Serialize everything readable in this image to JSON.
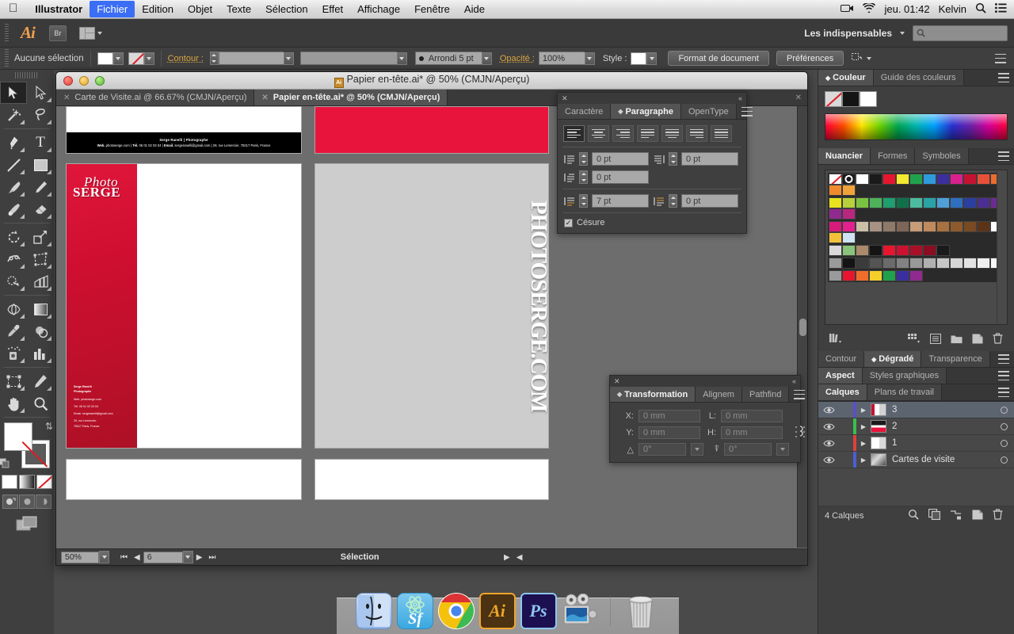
{
  "os_menubar": {
    "apple_icon": "apple-icon",
    "app_name": "Illustrator",
    "menus": [
      "Fichier",
      "Edition",
      "Objet",
      "Texte",
      "Sélection",
      "Effet",
      "Affichage",
      "Fenêtre",
      "Aide"
    ],
    "active_menu": "Fichier",
    "status": {
      "screen_record_icon": "video-camera-icon",
      "wifi_icon": "wifi-icon",
      "datetime": "jeu. 01:42",
      "user": "Kelvin",
      "search_icon": "search-icon",
      "notification_icon": "notification-list-icon"
    }
  },
  "appbar": {
    "logo": "Ai",
    "bridge_label": "Br",
    "arrange_icon": "arrange-documents-icon",
    "workspace": "Les indispensables",
    "workspace_caret": "chevron-down-icon",
    "search_placeholder": "",
    "search_icon": "search-icon"
  },
  "controlbar": {
    "selection_status": "Aucune sélection",
    "fill_swatch": "white",
    "stroke_swatch": "none",
    "stroke_label": "Contour :",
    "stroke_weight": "",
    "stroke_profile": "",
    "brush_label": "Arrondi 5 pt",
    "opacity_label": "Opacité :",
    "opacity_value": "100%",
    "style_label": "Style :",
    "doc_setup_button": "Format de document",
    "preferences_button": "Préférences",
    "align_icon": "align-icon",
    "panel_menu_icon": "panel-menu-icon"
  },
  "tools": {
    "rows": [
      [
        "selection-tool",
        "direct-selection-tool"
      ],
      [
        "magic-wand-tool",
        "lasso-tool"
      ],
      [
        "pen-tool",
        "type-tool"
      ],
      [
        "line-segment-tool",
        "rectangle-tool"
      ],
      [
        "paintbrush-tool",
        "pencil-tool"
      ],
      [
        "blob-brush-tool",
        "eraser-tool"
      ],
      [
        "rotate-tool",
        "scale-tool"
      ],
      [
        "width-tool",
        "free-transform-tool"
      ],
      [
        "shape-builder-tool",
        "perspective-grid-tool"
      ],
      [
        "mesh-tool",
        "gradient-tool"
      ],
      [
        "eyedropper-tool",
        "blend-tool"
      ],
      [
        "symbol-sprayer-tool",
        "column-graph-tool"
      ],
      [
        "artboard-tool",
        "slice-tool"
      ],
      [
        "hand-tool",
        "zoom-tool"
      ]
    ],
    "fill_color": "#ffffff",
    "stroke_color": "#ffffff",
    "swap_icon": "swap-fill-stroke-icon",
    "default_icon": "default-fill-stroke-icon",
    "mini_swatches": [
      "color-swatch",
      "gradient-swatch",
      "none-swatch"
    ],
    "draw_modes": [
      "draw-normal",
      "draw-behind",
      "draw-inside"
    ],
    "screen_mode_icon": "change-screen-mode-icon"
  },
  "document_window": {
    "title": "Papier en-tête.ai* @ 50% (CMJN/Aperçu)",
    "title_icon": "ai-document-icon",
    "traffic_lights": [
      "close-button",
      "minimize-button",
      "zoom-button"
    ],
    "tabs": [
      {
        "label": "Carte de Visite.ai @ 66.67% (CMJN/Aperçu)",
        "active": false,
        "close_icon": "close-tab-icon"
      },
      {
        "label": "Papier en-tête.ai* @ 50% (CMJN/Aperçu)",
        "active": true,
        "close_icon": "close-tab-icon"
      }
    ],
    "tabstrip_close_icon": "close-icon",
    "statusbar": {
      "zoom": "50%",
      "zoom_caret": "chevron-down-icon",
      "first_icon": "first-artboard-icon",
      "prev_icon": "previous-artboard-icon",
      "artboard": "6",
      "artboard_caret": "chevron-down-icon",
      "next_icon": "next-artboard-icon",
      "last_icon": "last-artboard-icon",
      "status_text": "Sélection",
      "status_caret": "status-menu-icon",
      "scroll_left_icon": "scroll-left-icon"
    }
  },
  "artwork": {
    "business_card": {
      "line1": "Serge Ranelli  |  Photographe",
      "line2_a": "Web.",
      "line2_b": " photoserge.com  |  ",
      "line2_c": "Tél.",
      "line2_d": " 06 01 02 03 04  |  ",
      "line2_e": "Email.",
      "line2_f": " sergeranelli@gmail.com  |  29, rue Lemercier, 75017 Paris, France"
    },
    "red_block_color": "#e8143c",
    "letterhead": {
      "logo_script": "Photo",
      "logo_name": "SERGE",
      "contact": [
        "Serge Ranelli",
        "Photographe",
        "Web. photoserge.com",
        "Tél. 06 01 02 03 04",
        "Email. sergeranelli@gmail.com",
        "29, rue Lemercier,",
        "75017 Paris, France"
      ],
      "band_color": "#cf0f30"
    },
    "gray_sheet": {
      "vertical_text": "PHOTOSERGE.COM",
      "background": "#cdcdcd"
    }
  },
  "paragraph_panel": {
    "close_icon": "close-icon",
    "collapse_icon": "collapse-panel-icon",
    "tabs": [
      "Caractère",
      "Paragraphe",
      "OpenType"
    ],
    "active_tab": "Paragraphe",
    "menu_icon": "panel-menu-icon",
    "align_buttons": [
      "align-left",
      "align-center",
      "align-right",
      "justify-last-left",
      "justify-last-center",
      "justify-last-right",
      "justify-all"
    ],
    "active_align": "align-left",
    "fields": [
      {
        "icon": "indent-left-icon",
        "value": "0 pt"
      },
      {
        "icon": "indent-right-icon",
        "value": "0 pt"
      },
      {
        "icon": "first-line-indent-icon",
        "value": "0 pt"
      },
      {
        "icon": "space-before-icon",
        "value": "7 pt"
      },
      {
        "icon": "space-after-icon",
        "value": "0 pt"
      }
    ],
    "hyphenate_label": "Césure",
    "hyphenate_checked": true
  },
  "transform_panel": {
    "close_icon": "close-icon",
    "collapse_icon": "collapse-panel-icon",
    "tabs": [
      "Transformation",
      "Alignem",
      "Pathfind"
    ],
    "active_tab": "Transformation",
    "menu_icon": "panel-menu-icon",
    "reference_point_icon": "reference-point-grid",
    "fields": {
      "x_label": "X:",
      "x_value": "0 mm",
      "y_label": "Y:",
      "y_value": "0 mm",
      "w_label": "L:",
      "w_value": "0 mm",
      "h_label": "H:",
      "h_value": "0 mm",
      "rotate_label": "rotate-icon",
      "rotate_value": "0°",
      "shear_label": "shear-icon",
      "shear_value": "0°"
    },
    "link_icon": "constrain-proportions-icon"
  },
  "dock_panels": {
    "color_group": {
      "tabs": [
        "Couleur",
        "Guide des couleurs"
      ],
      "active_tab": "Couleur",
      "menu_icon": "panel-menu-icon",
      "swatches": [
        "none-swatch",
        "black-swatch",
        "white-swatch"
      ],
      "spectrum_icon": "color-spectrum-ramp"
    },
    "swatches_group": {
      "tabs": [
        "Nuancier",
        "Formes",
        "Symboles"
      ],
      "active_tab": "Nuancier",
      "menu_icon": "panel-menu-icon",
      "colors_row1": [
        "#ffffff",
        "#9a9a9a",
        "#ffffff",
        "#1a1a1a",
        "#e8152f",
        "#f4e832",
        "#22a14c",
        "#2e9bdd",
        "#3b2fa0",
        "#d9208e",
        "#c41230",
        "#e8503a",
        "#ec6c2d",
        "#ef8b2c",
        "#f0a33a"
      ],
      "colors_row2": [
        "#e8e21f",
        "#b8d13a",
        "#7cc242",
        "#4fb15a",
        "#1f9e6e",
        "#10704a",
        "#4dbba0",
        "#2aa3a6",
        "#4f9fd8",
        "#2f6fc0",
        "#2a3f9e",
        "#4b2e91",
        "#6d2a91",
        "#8f2a8f",
        "#b8277f"
      ],
      "colors_row3": [
        "#d61b7a",
        "#e2218f",
        "#cbbfa8",
        "#a79182",
        "#8f7a6a",
        "#7d6557",
        "#c79c78",
        "#c08a5d",
        "#a9713f",
        "#8e5a2b",
        "#7a4a22",
        "#5c3317",
        "#ffffff",
        "#f4c23a",
        "#cfe3f2"
      ],
      "colors_row4": [
        "#d9d9d9",
        "#8ac37a",
        "#a98a6a",
        "#141414",
        "#e8152f",
        "#cc1230",
        "#a81028",
        "#8a0d21",
        "#1a1a1a"
      ],
      "colors_row5": [
        "#9a9a9a",
        "#141414",
        "#3b3b3b",
        "#545454",
        "#6b6b6b",
        "#828282",
        "#999999",
        "#b0b0b0",
        "#c7c7c7",
        "#d6d6d6",
        "#e3e3e3",
        "#f0f0f0",
        "#fafafa"
      ],
      "colors_row6": [
        "#9a9a9a",
        "#e8152f",
        "#ef6c2c",
        "#f4cf2a",
        "#22a14c",
        "#3b2fa0",
        "#8f2a8f"
      ],
      "footer_icons": [
        "swatch-libraries-icon",
        "show-swatch-kinds-icon",
        "swatch-options-icon",
        "new-color-group-icon",
        "new-swatch-icon",
        "delete-swatch-icon"
      ]
    },
    "stroke_group": {
      "tabs": [
        "Contour",
        "Dégradé",
        "Transparence"
      ],
      "active_tab": "Dégradé",
      "menu_icon": "panel-menu-icon"
    },
    "appearance_group": {
      "tabs": [
        "Aspect",
        "Styles graphiques"
      ],
      "active_tab": "Aspect",
      "menu_icon": "panel-menu-icon"
    },
    "layers_group": {
      "tabs": [
        "Calques",
        "Plans de travail"
      ],
      "active_tab": "Calques",
      "menu_icon": "panel-menu-icon",
      "rows": [
        {
          "name": "3",
          "color": "#5b4fc4",
          "selected": true,
          "eye_icon": "eye-icon",
          "expand_icon": "disclosure-triangle-icon",
          "target_icon": "target-circle-icon"
        },
        {
          "name": "2",
          "color": "#3bbf4a",
          "selected": false,
          "eye_icon": "eye-icon",
          "expand_icon": "disclosure-triangle-icon",
          "target_icon": "target-circle-icon"
        },
        {
          "name": "1",
          "color": "#e0403c",
          "selected": false,
          "eye_icon": "eye-icon",
          "expand_icon": "disclosure-triangle-icon",
          "target_icon": "target-circle-icon"
        },
        {
          "name": "Cartes de visite",
          "color": "#4a5fd0",
          "selected": false,
          "eye_icon": "eye-icon",
          "expand_icon": "disclosure-triangle-icon",
          "target_icon": "target-circle-icon"
        }
      ],
      "footer_count": "4 Calques",
      "footer_icons": [
        "locate-object-icon",
        "make-clipping-mask-icon",
        "create-new-sublayer-icon",
        "create-new-layer-icon",
        "delete-layer-icon"
      ]
    }
  },
  "mac_dock": {
    "items": [
      {
        "name": "finder-icon",
        "label": "Finder"
      },
      {
        "name": "sparkleshare-icon",
        "label": "Sf"
      },
      {
        "name": "chrome-icon",
        "label": "Chrome"
      },
      {
        "name": "illustrator-icon",
        "label": "Ai"
      },
      {
        "name": "photoshop-icon",
        "label": "Ps"
      },
      {
        "name": "imovie-icon",
        "label": "iMovie"
      },
      {
        "name": "trash-icon",
        "label": "Corbeille"
      }
    ]
  }
}
